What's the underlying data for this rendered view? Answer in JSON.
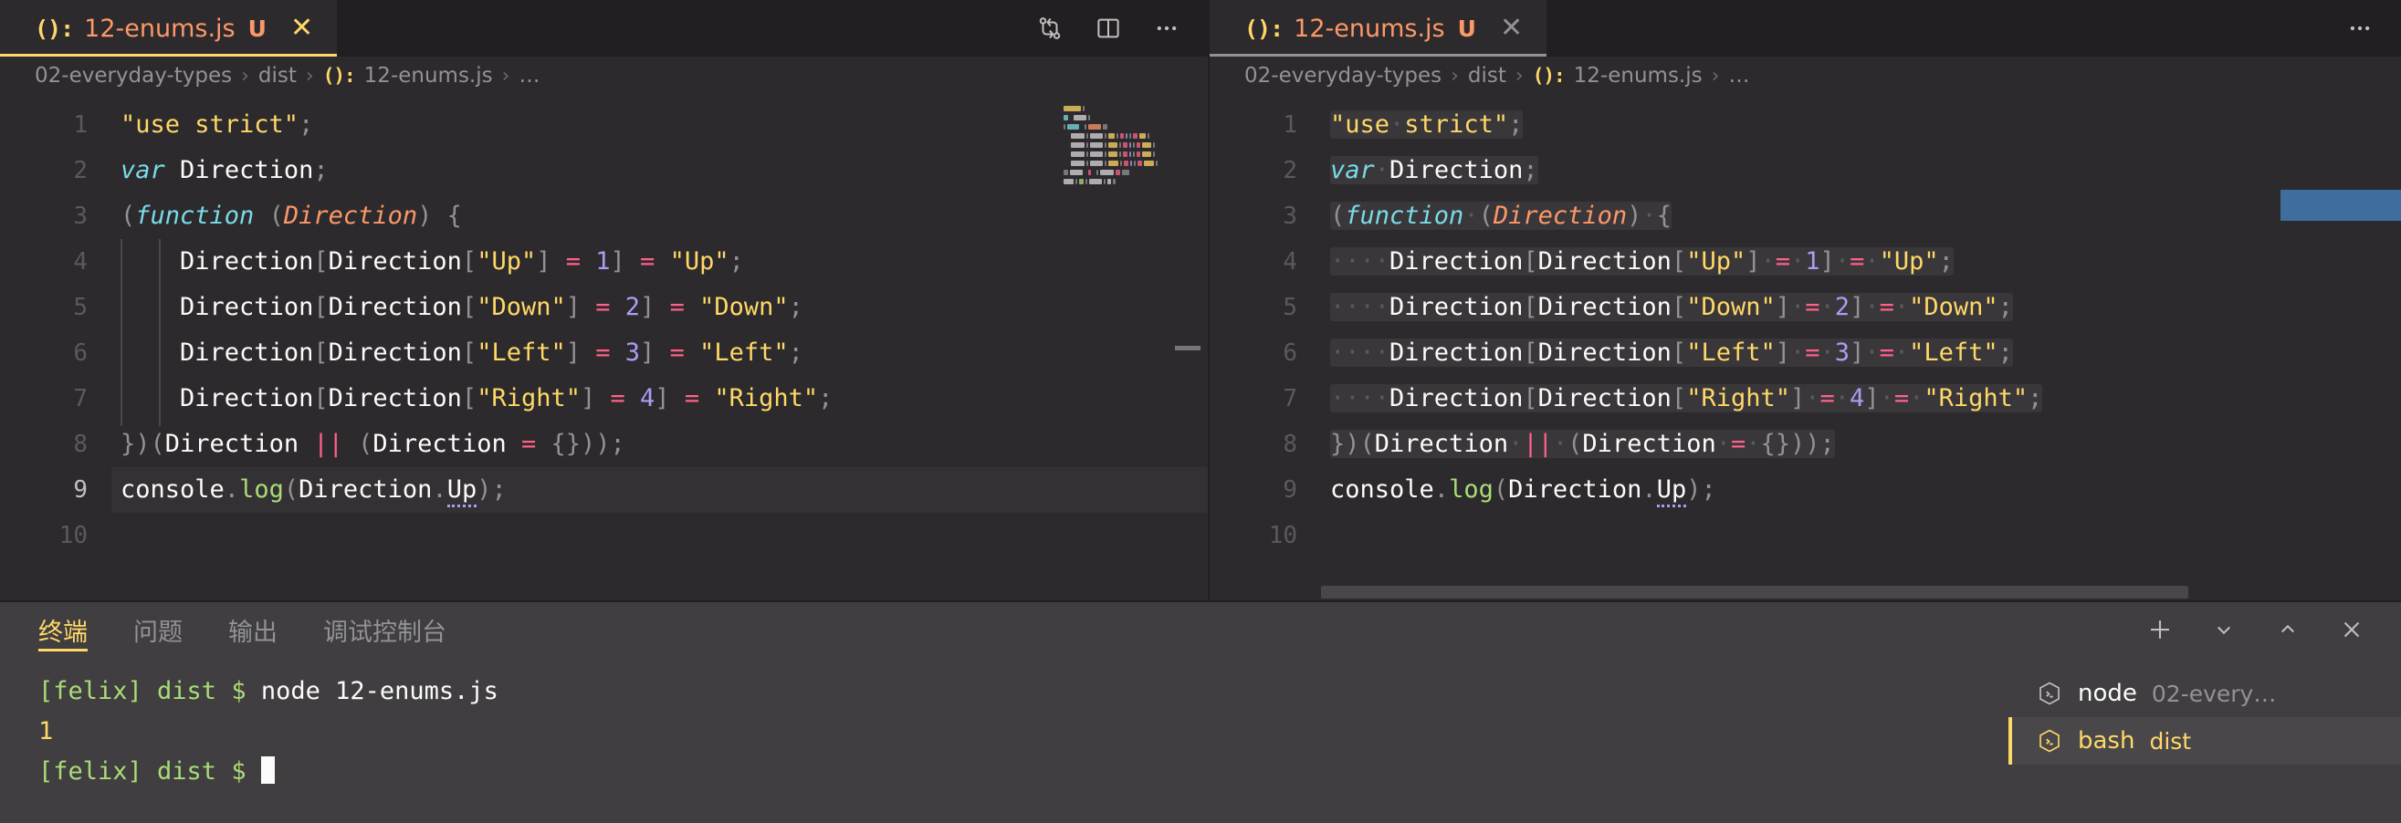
{
  "theme": {
    "bg": "#221f22",
    "editor_bg": "#2d2a2e",
    "panel_bg": "#403e41",
    "accent": "#ffd866",
    "string": "#ffd866",
    "keyword": "#78dce8",
    "parameter": "#fc9867",
    "number": "#ab9df2",
    "operator": "#ff6188",
    "punctuation": "#939293",
    "function": "#a9dc76",
    "text": "#fcfcfa",
    "line_number": "#5b595c"
  },
  "editor_left": {
    "tab": {
      "icon": "js-file-icon",
      "icon_glyph": "():",
      "label": "12-enums.js",
      "dirty_badge": "U",
      "close_glyph": "✕"
    },
    "actions": [
      {
        "name": "compare-changes-icon",
        "title": "compare"
      },
      {
        "name": "split-editor-icon",
        "title": "split editor"
      },
      {
        "name": "more-actions-icon",
        "title": "more",
        "glyph": "···"
      }
    ],
    "breadcrumb": {
      "parts": [
        "02-everyday-types",
        "dist",
        "12-enums.js",
        "…"
      ],
      "sep": "›",
      "icon_glyph": "():"
    },
    "line_numbers": [
      "1",
      "2",
      "3",
      "4",
      "5",
      "6",
      "7",
      "8",
      "9",
      "10"
    ],
    "current_line": 9,
    "code_lines": [
      {
        "n": 1,
        "tokens": [
          {
            "t": "\"use strict\"",
            "c": "t-str"
          },
          {
            "t": ";",
            "c": "t-pun"
          }
        ]
      },
      {
        "n": 2,
        "tokens": [
          {
            "t": "var",
            "c": "t-kw"
          },
          {
            "t": " ",
            "c": "t-txt"
          },
          {
            "t": "Direction",
            "c": "t-txt"
          },
          {
            "t": ";",
            "c": "t-pun"
          }
        ]
      },
      {
        "n": 3,
        "tokens": [
          {
            "t": "(",
            "c": "t-pun"
          },
          {
            "t": "function",
            "c": "t-kw"
          },
          {
            "t": " ",
            "c": "t-txt"
          },
          {
            "t": "(",
            "c": "t-pun"
          },
          {
            "t": "Direction",
            "c": "t-par"
          },
          {
            "t": ") {",
            "c": "t-pun"
          }
        ]
      },
      {
        "n": 4,
        "tokens": [
          {
            "t": "    ",
            "c": "t-txt"
          },
          {
            "t": "Direction",
            "c": "t-txt"
          },
          {
            "t": "[",
            "c": "t-pun"
          },
          {
            "t": "Direction",
            "c": "t-txt"
          },
          {
            "t": "[",
            "c": "t-pun"
          },
          {
            "t": "\"Up\"",
            "c": "t-str"
          },
          {
            "t": "]",
            "c": "t-pun"
          },
          {
            "t": " = ",
            "c": "t-op"
          },
          {
            "t": "1",
            "c": "t-num"
          },
          {
            "t": "]",
            "c": "t-pun"
          },
          {
            "t": " = ",
            "c": "t-op"
          },
          {
            "t": "\"Up\"",
            "c": "t-str"
          },
          {
            "t": ";",
            "c": "t-pun"
          }
        ]
      },
      {
        "n": 5,
        "tokens": [
          {
            "t": "    ",
            "c": "t-txt"
          },
          {
            "t": "Direction",
            "c": "t-txt"
          },
          {
            "t": "[",
            "c": "t-pun"
          },
          {
            "t": "Direction",
            "c": "t-txt"
          },
          {
            "t": "[",
            "c": "t-pun"
          },
          {
            "t": "\"Down\"",
            "c": "t-str"
          },
          {
            "t": "]",
            "c": "t-pun"
          },
          {
            "t": " = ",
            "c": "t-op"
          },
          {
            "t": "2",
            "c": "t-num"
          },
          {
            "t": "]",
            "c": "t-pun"
          },
          {
            "t": " = ",
            "c": "t-op"
          },
          {
            "t": "\"Down\"",
            "c": "t-str"
          },
          {
            "t": ";",
            "c": "t-pun"
          }
        ]
      },
      {
        "n": 6,
        "tokens": [
          {
            "t": "    ",
            "c": "t-txt"
          },
          {
            "t": "Direction",
            "c": "t-txt"
          },
          {
            "t": "[",
            "c": "t-pun"
          },
          {
            "t": "Direction",
            "c": "t-txt"
          },
          {
            "t": "[",
            "c": "t-pun"
          },
          {
            "t": "\"Left\"",
            "c": "t-str"
          },
          {
            "t": "]",
            "c": "t-pun"
          },
          {
            "t": " = ",
            "c": "t-op"
          },
          {
            "t": "3",
            "c": "t-num"
          },
          {
            "t": "]",
            "c": "t-pun"
          },
          {
            "t": " = ",
            "c": "t-op"
          },
          {
            "t": "\"Left\"",
            "c": "t-str"
          },
          {
            "t": ";",
            "c": "t-pun"
          }
        ]
      },
      {
        "n": 7,
        "tokens": [
          {
            "t": "    ",
            "c": "t-txt"
          },
          {
            "t": "Direction",
            "c": "t-txt"
          },
          {
            "t": "[",
            "c": "t-pun"
          },
          {
            "t": "Direction",
            "c": "t-txt"
          },
          {
            "t": "[",
            "c": "t-pun"
          },
          {
            "t": "\"Right\"",
            "c": "t-str"
          },
          {
            "t": "]",
            "c": "t-pun"
          },
          {
            "t": " = ",
            "c": "t-op"
          },
          {
            "t": "4",
            "c": "t-num"
          },
          {
            "t": "]",
            "c": "t-pun"
          },
          {
            "t": " = ",
            "c": "t-op"
          },
          {
            "t": "\"Right\"",
            "c": "t-str"
          },
          {
            "t": ";",
            "c": "t-pun"
          }
        ]
      },
      {
        "n": 8,
        "tokens": [
          {
            "t": "})(",
            "c": "t-pun"
          },
          {
            "t": "Direction",
            "c": "t-txt"
          },
          {
            "t": " ",
            "c": "t-txt"
          },
          {
            "t": "||",
            "c": "t-op"
          },
          {
            "t": " ",
            "c": "t-txt"
          },
          {
            "t": "(",
            "c": "t-pun"
          },
          {
            "t": "Direction",
            "c": "t-txt"
          },
          {
            "t": " = ",
            "c": "t-op"
          },
          {
            "t": "{}));",
            "c": "t-pun"
          }
        ]
      },
      {
        "n": 9,
        "tokens": [
          {
            "t": "console",
            "c": "t-txt"
          },
          {
            "t": ".",
            "c": "t-pun"
          },
          {
            "t": "log",
            "c": "t-fn"
          },
          {
            "t": "(",
            "c": "t-pun"
          },
          {
            "t": "Direction",
            "c": "t-txt"
          },
          {
            "t": ".",
            "c": "t-pun"
          },
          {
            "t": "Up",
            "c": "t-txt squiggle"
          },
          {
            "t": ");",
            "c": "t-pun"
          }
        ]
      },
      {
        "n": 10,
        "tokens": []
      }
    ]
  },
  "editor_right": {
    "tab": {
      "icon": "js-file-icon",
      "icon_glyph": "():",
      "label": "12-enums.js",
      "dirty_badge": "U",
      "close_glyph": "✕"
    },
    "actions": [
      {
        "name": "more-actions-icon",
        "glyph": "···"
      }
    ],
    "breadcrumb": {
      "parts": [
        "02-everyday-types",
        "dist",
        "12-enums.js",
        "…"
      ],
      "sep": "›",
      "icon_glyph": "():"
    },
    "line_numbers": [
      "1",
      "2",
      "3",
      "4",
      "5",
      "6",
      "7",
      "8",
      "9",
      "10"
    ],
    "render_whitespace": true,
    "code_lines": [
      {
        "n": 1,
        "sel": true,
        "tokens": [
          {
            "t": "\"use",
            "c": "t-str"
          },
          {
            "t": "·",
            "c": "t-ws"
          },
          {
            "t": "strict\"",
            "c": "t-str"
          },
          {
            "t": ";",
            "c": "t-pun"
          }
        ]
      },
      {
        "n": 2,
        "sel": true,
        "tokens": [
          {
            "t": "var",
            "c": "t-kw"
          },
          {
            "t": "·",
            "c": "t-ws"
          },
          {
            "t": "Direction",
            "c": "t-txt"
          },
          {
            "t": ";",
            "c": "t-pun"
          }
        ]
      },
      {
        "n": 3,
        "sel": true,
        "tokens": [
          {
            "t": "(",
            "c": "t-pun"
          },
          {
            "t": "function",
            "c": "t-kw"
          },
          {
            "t": "·",
            "c": "t-ws"
          },
          {
            "t": "(",
            "c": "t-pun"
          },
          {
            "t": "Direction",
            "c": "t-par"
          },
          {
            "t": ")",
            "c": "t-pun"
          },
          {
            "t": "·",
            "c": "t-ws"
          },
          {
            "t": "{",
            "c": "t-pun"
          }
        ]
      },
      {
        "n": 4,
        "sel": true,
        "tokens": [
          {
            "t": "····",
            "c": "t-ws"
          },
          {
            "t": "Direction",
            "c": "t-txt"
          },
          {
            "t": "[",
            "c": "t-pun"
          },
          {
            "t": "Direction",
            "c": "t-txt"
          },
          {
            "t": "[",
            "c": "t-pun"
          },
          {
            "t": "\"Up\"",
            "c": "t-str"
          },
          {
            "t": "]",
            "c": "t-pun"
          },
          {
            "t": "·",
            "c": "t-ws"
          },
          {
            "t": "=",
            "c": "t-op"
          },
          {
            "t": "·",
            "c": "t-ws"
          },
          {
            "t": "1",
            "c": "t-num"
          },
          {
            "t": "]",
            "c": "t-pun"
          },
          {
            "t": "·",
            "c": "t-ws"
          },
          {
            "t": "=",
            "c": "t-op"
          },
          {
            "t": "·",
            "c": "t-ws"
          },
          {
            "t": "\"Up\"",
            "c": "t-str"
          },
          {
            "t": ";",
            "c": "t-pun"
          }
        ]
      },
      {
        "n": 5,
        "sel": true,
        "tokens": [
          {
            "t": "····",
            "c": "t-ws"
          },
          {
            "t": "Direction",
            "c": "t-txt"
          },
          {
            "t": "[",
            "c": "t-pun"
          },
          {
            "t": "Direction",
            "c": "t-txt"
          },
          {
            "t": "[",
            "c": "t-pun"
          },
          {
            "t": "\"Down\"",
            "c": "t-str"
          },
          {
            "t": "]",
            "c": "t-pun"
          },
          {
            "t": "·",
            "c": "t-ws"
          },
          {
            "t": "=",
            "c": "t-op"
          },
          {
            "t": "·",
            "c": "t-ws"
          },
          {
            "t": "2",
            "c": "t-num"
          },
          {
            "t": "]",
            "c": "t-pun"
          },
          {
            "t": "·",
            "c": "t-ws"
          },
          {
            "t": "=",
            "c": "t-op"
          },
          {
            "t": "·",
            "c": "t-ws"
          },
          {
            "t": "\"Down\"",
            "c": "t-str"
          },
          {
            "t": ";",
            "c": "t-pun"
          }
        ]
      },
      {
        "n": 6,
        "sel": true,
        "tokens": [
          {
            "t": "····",
            "c": "t-ws"
          },
          {
            "t": "Direction",
            "c": "t-txt"
          },
          {
            "t": "[",
            "c": "t-pun"
          },
          {
            "t": "Direction",
            "c": "t-txt"
          },
          {
            "t": "[",
            "c": "t-pun"
          },
          {
            "t": "\"Left\"",
            "c": "t-str"
          },
          {
            "t": "]",
            "c": "t-pun"
          },
          {
            "t": "·",
            "c": "t-ws"
          },
          {
            "t": "=",
            "c": "t-op"
          },
          {
            "t": "·",
            "c": "t-ws"
          },
          {
            "t": "3",
            "c": "t-num"
          },
          {
            "t": "]",
            "c": "t-pun"
          },
          {
            "t": "·",
            "c": "t-ws"
          },
          {
            "t": "=",
            "c": "t-op"
          },
          {
            "t": "·",
            "c": "t-ws"
          },
          {
            "t": "\"Left\"",
            "c": "t-str"
          },
          {
            "t": ";",
            "c": "t-pun"
          }
        ]
      },
      {
        "n": 7,
        "sel": true,
        "tokens": [
          {
            "t": "····",
            "c": "t-ws"
          },
          {
            "t": "Direction",
            "c": "t-txt"
          },
          {
            "t": "[",
            "c": "t-pun"
          },
          {
            "t": "Direction",
            "c": "t-txt"
          },
          {
            "t": "[",
            "c": "t-pun"
          },
          {
            "t": "\"Right\"",
            "c": "t-str"
          },
          {
            "t": "]",
            "c": "t-pun"
          },
          {
            "t": "·",
            "c": "t-ws"
          },
          {
            "t": "=",
            "c": "t-op"
          },
          {
            "t": "·",
            "c": "t-ws"
          },
          {
            "t": "4",
            "c": "t-num"
          },
          {
            "t": "]",
            "c": "t-pun"
          },
          {
            "t": "·",
            "c": "t-ws"
          },
          {
            "t": "=",
            "c": "t-op"
          },
          {
            "t": "·",
            "c": "t-ws"
          },
          {
            "t": "\"Right\"",
            "c": "t-str"
          },
          {
            "t": ";",
            "c": "t-pun"
          }
        ]
      },
      {
        "n": 8,
        "sel": true,
        "tokens": [
          {
            "t": "})(",
            "c": "t-pun"
          },
          {
            "t": "Direction",
            "c": "t-txt"
          },
          {
            "t": "·",
            "c": "t-ws"
          },
          {
            "t": "||",
            "c": "t-op"
          },
          {
            "t": "·",
            "c": "t-ws"
          },
          {
            "t": "(",
            "c": "t-pun"
          },
          {
            "t": "Direction",
            "c": "t-txt"
          },
          {
            "t": "·",
            "c": "t-ws"
          },
          {
            "t": "=",
            "c": "t-op"
          },
          {
            "t": "·",
            "c": "t-ws"
          },
          {
            "t": "{}));",
            "c": "t-pun"
          }
        ]
      },
      {
        "n": 9,
        "sel": false,
        "tokens": [
          {
            "t": "console",
            "c": "t-txt"
          },
          {
            "t": ".",
            "c": "t-pun"
          },
          {
            "t": "log",
            "c": "t-fn"
          },
          {
            "t": "(",
            "c": "t-pun"
          },
          {
            "t": "Direction",
            "c": "t-txt"
          },
          {
            "t": ".",
            "c": "t-pun"
          },
          {
            "t": "Up",
            "c": "t-txt squiggle"
          },
          {
            "t": ");",
            "c": "t-pun"
          }
        ]
      },
      {
        "n": 10,
        "sel": false,
        "tokens": []
      }
    ]
  },
  "panel": {
    "tabs": [
      {
        "label": "终端",
        "active": true
      },
      {
        "label": "问题",
        "active": false
      },
      {
        "label": "输出",
        "active": false
      },
      {
        "label": "调试控制台",
        "active": false
      }
    ],
    "actions": [
      {
        "name": "new-terminal-icon",
        "glyph": "+"
      },
      {
        "name": "chevron-down-icon",
        "glyph": "⌄"
      },
      {
        "name": "maximize-panel-icon",
        "glyph": "⌃"
      },
      {
        "name": "close-panel-icon",
        "glyph": "✕"
      }
    ],
    "terminal": {
      "lines": [
        {
          "prompt": "[felix] dist $ ",
          "command": "node 12-enums.js",
          "kind": "cmd"
        },
        {
          "prompt": "",
          "command": "1",
          "kind": "out"
        },
        {
          "prompt": "[felix] dist $ ",
          "command": "",
          "kind": "cmd-cursor"
        }
      ]
    },
    "terminal_list": [
      {
        "icon": "terminal-box-icon",
        "name": "node",
        "sub": "02-every…",
        "selected": false
      },
      {
        "icon": "terminal-box-icon",
        "name": "bash",
        "sub": "dist",
        "selected": true
      }
    ]
  }
}
